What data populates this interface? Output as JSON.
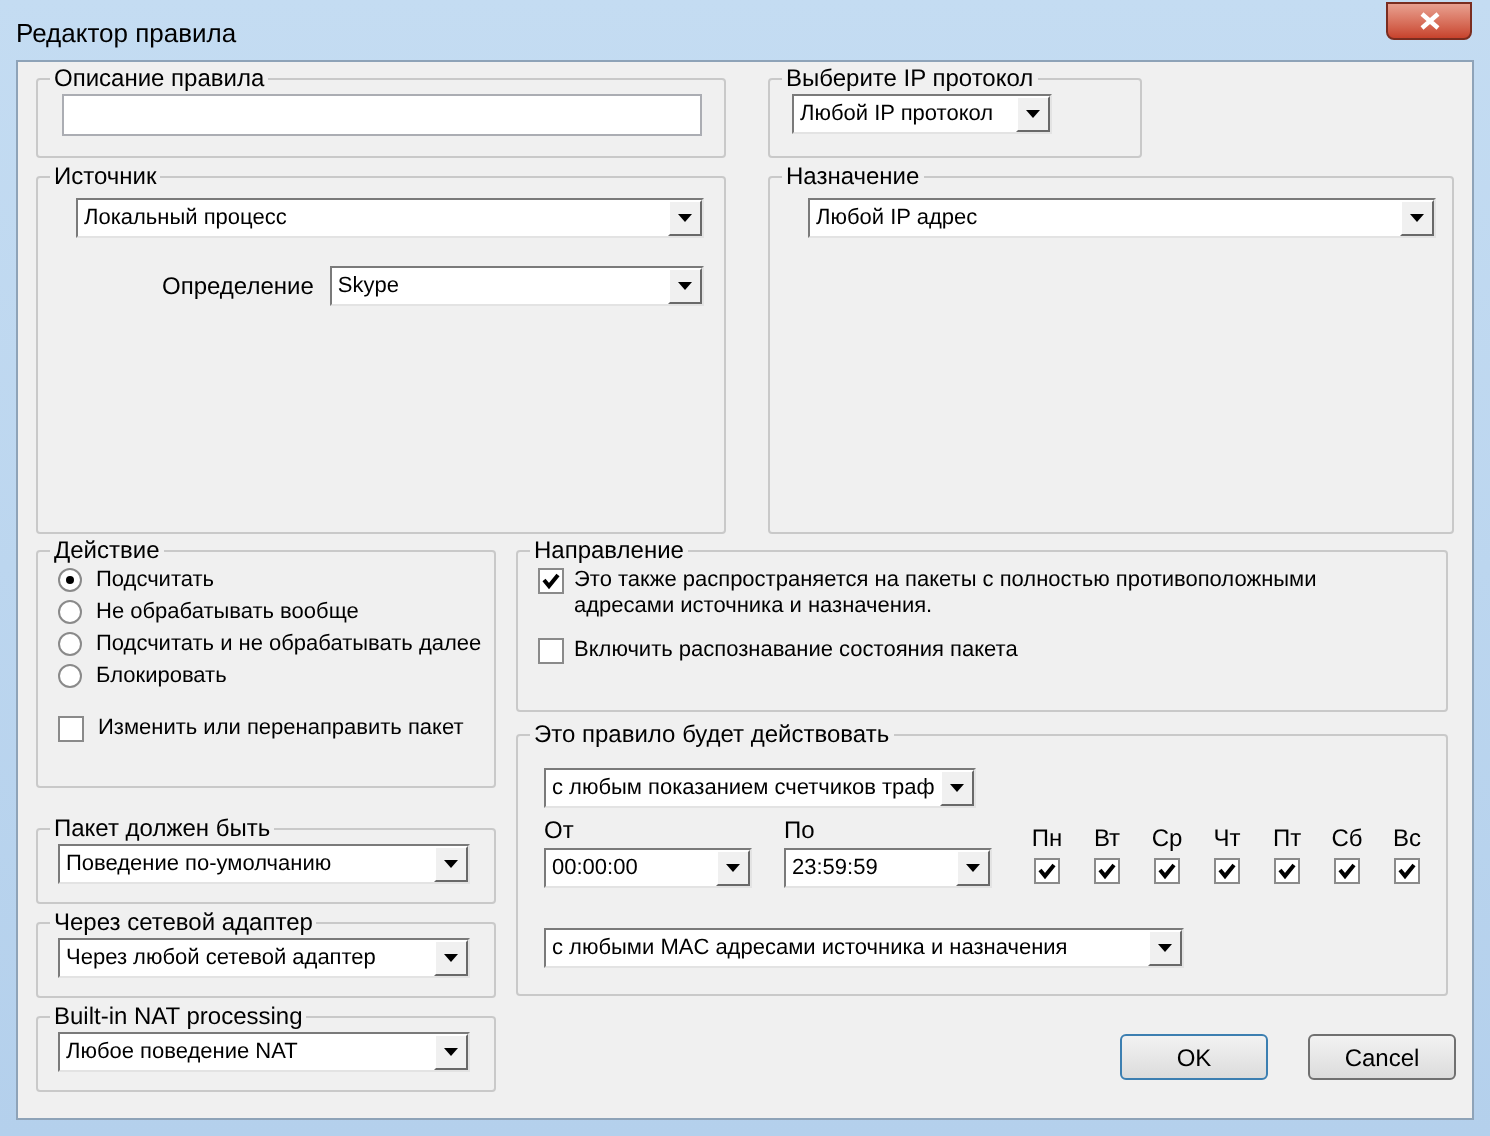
{
  "window": {
    "title": "Редактор правила"
  },
  "description": {
    "label": "Описание правила"
  },
  "protocol": {
    "label": "Выберите IP протокол",
    "value": "Любой IP протокол"
  },
  "source": {
    "label": "Источник",
    "value": "Локальный процесс",
    "definition_label": "Определение",
    "definition": "Skype"
  },
  "destination": {
    "label": "Назначение",
    "value": "Любой IP адрес"
  },
  "action": {
    "label": "Действие",
    "options": [
      {
        "label": "Подсчитать",
        "selected": true
      },
      {
        "label": "Не обрабатывать вообще",
        "selected": false
      },
      {
        "label": "Подсчитать и не обрабатывать далее",
        "selected": false
      },
      {
        "label": "Блокировать",
        "selected": false
      }
    ],
    "modify": {
      "label": "Изменить или перенаправить пакет",
      "checked": false
    }
  },
  "packet": {
    "label": "Пакет должен быть",
    "value": "Поведение по-умолчанию"
  },
  "adapter": {
    "label": "Через сетевой адаптер",
    "value": "Через любой сетевой адаптер"
  },
  "nat": {
    "label": "Built-in NAT processing",
    "value": "Любое поведение NAT"
  },
  "direction": {
    "label": "Направление",
    "options": [
      {
        "label": "Это также распространяется на пакеты с полностью противоположными адресами источника и назначения.",
        "checked": true
      },
      {
        "label": "Включить распознавание состояния пакета",
        "checked": false
      }
    ]
  },
  "schedule": {
    "label": "Это правило будет действовать",
    "traffic": "с любым показанием счетчиков траф",
    "from_label": "От",
    "from": "00:00:00",
    "to_label": "По",
    "to": "23:59:59",
    "days": [
      {
        "label": "Пн",
        "checked": true
      },
      {
        "label": "Вт",
        "checked": true
      },
      {
        "label": "Ср",
        "checked": true
      },
      {
        "label": "Чт",
        "checked": true
      },
      {
        "label": "Пт",
        "checked": true
      },
      {
        "label": "Сб",
        "checked": true
      },
      {
        "label": "Вс",
        "checked": true
      }
    ],
    "mac": "с любыми MAC адресами источника и назначения"
  },
  "buttons": [
    "OK",
    "Cancel"
  ]
}
